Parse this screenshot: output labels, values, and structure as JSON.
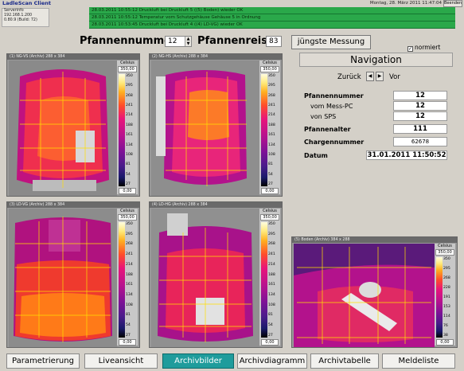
{
  "app": {
    "title": "LadleScan Client",
    "datetime": "Montag, 28. März 2011 11:47:04",
    "exit_label": "Beenden"
  },
  "server": {
    "label": "Serverinfo",
    "ip": "192.168.1.200",
    "version": "0.80.9 (Build: 72)"
  },
  "alarms": [
    "28.03.2011 10:55:12 Druckluft bei Druckluft 5 ((5) Boden) wieder OK",
    "28.03.2011 10:55:12 Temperatur vom Schutzgehäuse Gehäuse 5 in Ordnung",
    "28.03.2011 10:53:45 Druckluft bei Druckluft 4 ((4) LD-VG) wieder OK"
  ],
  "header": {
    "ladle_number_label": "Pfannennummer",
    "ladle_number": "12",
    "ladle_trip_label": "Pfannenreise",
    "ladle_trip": "83",
    "newest_button": "jüngste Messung",
    "normalized_label": "normiert",
    "normalized_checked": true
  },
  "panels": [
    {
      "title": "(1) NG-VS (Archiv)   288 x 384",
      "scale": {
        "unit": "Celsius",
        "max": "350,00",
        "min": "0,00",
        "ticks": [
          "350",
          "295",
          "268",
          "241",
          "214",
          "188",
          "161",
          "134",
          "108",
          "81",
          "54",
          "27"
        ]
      }
    },
    {
      "title": "(2) NG-HS (Archiv)   288 x 384",
      "scale": {
        "unit": "Celsius",
        "max": "350,00",
        "min": "0,00",
        "ticks": [
          "350",
          "295",
          "268",
          "241",
          "214",
          "188",
          "161",
          "134",
          "108",
          "81",
          "54",
          "27"
        ]
      }
    },
    {
      "title": "(3) LD-VG (Archiv)   288 x 384",
      "scale": {
        "unit": "Celsius",
        "max": "350,00",
        "min": "0,00",
        "ticks": [
          "350",
          "295",
          "268",
          "241",
          "214",
          "188",
          "161",
          "134",
          "108",
          "81",
          "54",
          "27"
        ]
      }
    },
    {
      "title": "(4) LD-HG (Archiv)   288 x 384",
      "scale": {
        "unit": "Celsius",
        "max": "350,00",
        "min": "0,00",
        "ticks": [
          "350",
          "295",
          "268",
          "241",
          "214",
          "188",
          "161",
          "134",
          "108",
          "81",
          "54",
          "27"
        ]
      }
    },
    {
      "title": "(5) Boden (Archiv)   384 x 288",
      "scale": {
        "unit": "Celsius",
        "max": "350,00",
        "min": "0,00",
        "ticks": [
          "350",
          "295",
          "268",
          "228",
          "191",
          "153",
          "114",
          "76",
          "38"
        ]
      }
    }
  ],
  "navigation": {
    "title": "Navigation",
    "back_label": "Zurück",
    "forward_label": "Vor",
    "back_arrow": "◀",
    "forward_arrow": "▶",
    "rows": {
      "ladle_number_label": "Pfannennummer",
      "ladle_number": "12",
      "from_pc_label": "vom Mess-PC",
      "from_pc": "12",
      "from_plc_label": "von SPS",
      "from_plc": "12",
      "age_label": "Pfannenalter",
      "age": "111",
      "charge_label": "Chargennummer",
      "charge": "62678",
      "date_label": "Datum",
      "date": "31.01.2011 11:50:52"
    }
  },
  "tabs": [
    {
      "label": "Parametrierung",
      "active": false
    },
    {
      "label": "Liveansicht",
      "active": false
    },
    {
      "label": "Archivbilder",
      "active": true
    },
    {
      "label": "Archivdiagramm",
      "active": false
    },
    {
      "label": "Archivtabelle",
      "active": false
    },
    {
      "label": "Meldeliste",
      "active": false
    }
  ],
  "colors": {
    "active_tab": "#1f9c9c",
    "alarm_ok": "#2aa84a"
  }
}
